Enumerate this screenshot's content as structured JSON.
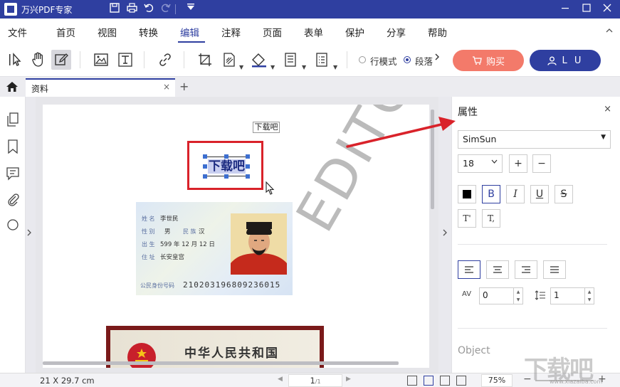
{
  "window": {
    "title": "万兴PDF专家",
    "quick_access": [
      "save-icon",
      "print-icon",
      "undo-icon",
      "redo-icon",
      "dropdown-icon"
    ],
    "controls": [
      "minimize-icon",
      "restore-icon",
      "close-icon"
    ]
  },
  "menu": {
    "items": [
      "文件",
      "首页",
      "视图",
      "转换",
      "编辑",
      "注释",
      "页面",
      "表单",
      "保护",
      "分享",
      "帮助"
    ],
    "active": "编辑"
  },
  "toolbar": {
    "tools": [
      "select-icon",
      "hand-icon",
      "edit-icon",
      "image-icon",
      "text-box-icon",
      "link-icon",
      "crop-icon",
      "watermark-icon",
      "background-icon",
      "header-footer-icon",
      "bates-icon"
    ],
    "mode_line": "行模式",
    "mode_paragraph": "段落",
    "mode_selected": "段落",
    "buy_label": "购买",
    "user_label": "L U"
  },
  "tabs": {
    "document_tab": "资料",
    "close_glyph": "×",
    "add_glyph": "+"
  },
  "document": {
    "small_label": "下载吧",
    "selected_text": "下载吧",
    "id_card": {
      "rows": [
        {
          "label": "姓 名",
          "value": "李世民"
        },
        {
          "label": "性 别",
          "value": "男"
        },
        {
          "label": "民 族",
          "value": "汉"
        },
        {
          "label": "出 生",
          "value": "599  年  12 月 12 日"
        },
        {
          "label": "住 址",
          "value": "长安皇宫"
        }
      ],
      "number_label": "公民身份号码",
      "number": "210203196809236015"
    },
    "id_back_title": "中华人民共和国",
    "watermark": "EDITOR"
  },
  "properties": {
    "title": "属性",
    "close_glyph": "×",
    "font_family": "SimSun",
    "font_size": "18",
    "plus": "+",
    "minus": "−",
    "style_buttons": [
      "color-swatch",
      "bold",
      "italic",
      "underline",
      "strikethrough",
      "superscript",
      "subscript"
    ],
    "bold_glyph": "B",
    "italic_glyph": "I",
    "underline_glyph": "U",
    "strike_glyph": "S",
    "super_glyph": "T'",
    "sub_glyph": "T,",
    "char_spacing": "0",
    "line_spacing": "1",
    "char_spacing_icon": "AV",
    "object_label": "Object"
  },
  "status": {
    "page_size": "21 X 29.7 cm",
    "page_current": "1",
    "page_total": "/1",
    "zoom": "75%"
  },
  "site_watermark": {
    "text": "下载吧",
    "url": "www.xiazaiba.com"
  },
  "colors": {
    "brand": "#2f3fa0",
    "buy": "#f37a6a",
    "highlight_frame": "#d9222a",
    "selection_handle": "#3d6fd0"
  }
}
